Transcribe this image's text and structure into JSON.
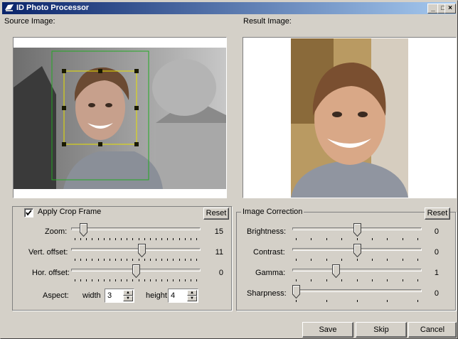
{
  "window": {
    "title": "ID Photo Processor",
    "minimize": "_",
    "maximize": "□",
    "close": "×"
  },
  "source": {
    "label": "Source Image:"
  },
  "result": {
    "label": "Result Image:"
  },
  "crop": {
    "label": "Apply Crop Frame",
    "checked": true,
    "reset_label": "Reset",
    "zoom": {
      "label": "Zoom:",
      "value": "15",
      "level": 0.07
    },
    "vert": {
      "label": "Vert. offset:",
      "value": "11",
      "level": 0.55
    },
    "hor": {
      "label": "Hor. offset:",
      "value": "0",
      "level": 0.5
    },
    "aspect": {
      "label": "Aspect:",
      "width_label": "width",
      "width_value": "3",
      "height_label": "height",
      "height_value": "4"
    }
  },
  "correction": {
    "label": "Image Correction",
    "reset_label": "Reset",
    "brightness": {
      "label": "Brightness:",
      "value": "0",
      "level": 0.5
    },
    "contrast": {
      "label": "Contrast:",
      "value": "0",
      "level": 0.5
    },
    "gamma": {
      "label": "Gamma:",
      "value": "1",
      "level": 0.33
    },
    "sharpness": {
      "label": "Sharpness:",
      "value": "0",
      "level": 0.0
    }
  },
  "buttons": {
    "save": "Save",
    "skip": "Skip",
    "cancel": "Cancel"
  },
  "colors": {
    "titlebar": "#0a246a",
    "crop_frame_outer": "#22aa22",
    "crop_frame_inner": "#e8e000"
  }
}
